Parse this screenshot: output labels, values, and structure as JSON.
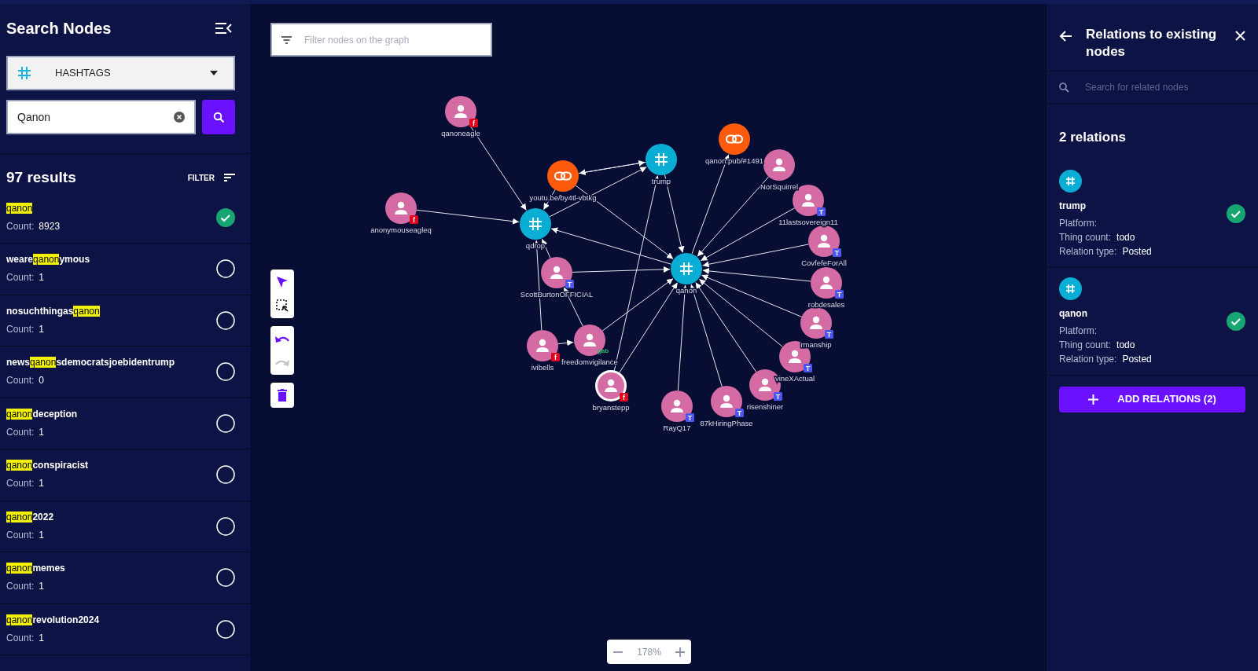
{
  "sidebar": {
    "title": "Search Nodes",
    "type_select": {
      "value": "HASHTAGS"
    },
    "search": {
      "value": "Qanon"
    },
    "results_count": "97 results",
    "filter_label": "FILTER",
    "results": [
      {
        "parts": [
          {
            "text": "qanon",
            "highlighted": true
          }
        ],
        "count_label": "Count:",
        "count": "8923",
        "selected": true
      },
      {
        "parts": [
          {
            "text": "weare",
            "highlighted": false
          },
          {
            "text": "qanon",
            "highlighted": true
          },
          {
            "text": "ymous",
            "highlighted": false
          }
        ],
        "count_label": "Count:",
        "count": "1",
        "selected": false
      },
      {
        "parts": [
          {
            "text": "nosuchthingas",
            "highlighted": false
          },
          {
            "text": "qanon",
            "highlighted": true
          }
        ],
        "count_label": "Count:",
        "count": "1",
        "selected": false
      },
      {
        "parts": [
          {
            "text": "news",
            "highlighted": false
          },
          {
            "text": "qanon",
            "highlighted": true
          },
          {
            "text": "sdemocratsjoebidentrump",
            "highlighted": false
          }
        ],
        "count_label": "Count:",
        "count": "0",
        "selected": false
      },
      {
        "parts": [
          {
            "text": "qanon",
            "highlighted": true
          },
          {
            "text": "deception",
            "highlighted": false
          }
        ],
        "count_label": "Count:",
        "count": "1",
        "selected": false
      },
      {
        "parts": [
          {
            "text": "qanon",
            "highlighted": true
          },
          {
            "text": "conspiracist",
            "highlighted": false
          }
        ],
        "count_label": "Count:",
        "count": "1",
        "selected": false
      },
      {
        "parts": [
          {
            "text": "qanon",
            "highlighted": true
          },
          {
            "text": "2022",
            "highlighted": false
          }
        ],
        "count_label": "Count:",
        "count": "1",
        "selected": false
      },
      {
        "parts": [
          {
            "text": "qanon",
            "highlighted": true
          },
          {
            "text": "memes",
            "highlighted": false
          }
        ],
        "count_label": "Count:",
        "count": "1",
        "selected": false
      },
      {
        "parts": [
          {
            "text": "qanon",
            "highlighted": true
          },
          {
            "text": "revolution2024",
            "highlighted": false
          }
        ],
        "count_label": "Count:",
        "count": "1",
        "selected": false
      }
    ]
  },
  "canvas": {
    "filter": {
      "placeholder": "Filter nodes on the graph"
    },
    "zoom": "178%",
    "toolbar": [
      {
        "tools": [
          {
            "kind": "pointer",
            "selected": true
          },
          {
            "kind": "marquee",
            "selected": false
          }
        ]
      },
      {
        "tools": [
          {
            "kind": "undo",
            "disabled": false
          },
          {
            "kind": "redo",
            "disabled": true
          }
        ]
      },
      {
        "tools": [
          {
            "kind": "delete"
          }
        ]
      }
    ],
    "graph": {
      "nodes": [
        {
          "label": "qanoneagle",
          "kind": "user",
          "badge": {
            "text": "f",
            "kind": "tile",
            "color": "#e0001b"
          },
          "selected": false
        },
        {
          "label": "anonymouseagleq",
          "kind": "user",
          "badge": {
            "text": "f",
            "kind": "tile",
            "color": "#e0001b"
          },
          "selected": false
        },
        {
          "label": "youtu.be/by4tl-vbtkg",
          "kind": "link",
          "selected": false
        },
        {
          "label": "qdrop",
          "kind": "hashtag",
          "selected": false
        },
        {
          "label": "trump",
          "kind": "hashtag",
          "selected": false
        },
        {
          "label": "qanon.pub/#1491",
          "kind": "link",
          "selected": false
        },
        {
          "label": "NorSquirrel",
          "kind": "user",
          "selected": false
        },
        {
          "label": "11lastsovereign11",
          "kind": "user",
          "badge": {
            "text": "T",
            "kind": "tile",
            "color": "#4b55f0"
          },
          "selected": false
        },
        {
          "label": "CovfefeForAll",
          "kind": "user",
          "badge": {
            "text": "T",
            "kind": "tile",
            "color": "#4b55f0"
          },
          "selected": false
        },
        {
          "label": "robdesales",
          "kind": "user",
          "badge": {
            "text": "T",
            "kind": "tile",
            "color": "#4b55f0"
          },
          "selected": false
        },
        {
          "label": "rmanship",
          "kind": "user",
          "badge": {
            "text": "T",
            "kind": "tile",
            "color": "#4b55f0"
          },
          "selected": false
        },
        {
          "label": "vineXActual",
          "kind": "user",
          "badge": {
            "text": "T",
            "kind": "tile",
            "color": "#4b55f0"
          },
          "selected": false
        },
        {
          "label": "ScottBurtonOFFICIAL",
          "kind": "user",
          "badge": {
            "text": "T",
            "kind": "tile",
            "color": "#4b55f0"
          },
          "selected": false
        },
        {
          "label": "qanon",
          "kind": "hashtag",
          "selected": false
        },
        {
          "label": "ivibells",
          "kind": "user",
          "badge": {
            "text": "f",
            "kind": "tile",
            "color": "#e0001b"
          },
          "selected": false
        },
        {
          "label": "freedomvigilance",
          "kind": "user",
          "badge": {
            "text": "gab",
            "kind": "tag",
            "color": "#1fbf6a"
          },
          "selected": false
        },
        {
          "label": "bryanstepp",
          "kind": "user",
          "badge": {
            "text": "f",
            "kind": "tile",
            "color": "#e0001b"
          },
          "selected": true
        },
        {
          "label": "RayQ17",
          "kind": "user",
          "badge": {
            "text": "T",
            "kind": "tile",
            "color": "#4b55f0"
          },
          "selected": false
        },
        {
          "label": "87kHiringPhase",
          "kind": "user",
          "badge": {
            "text": "T",
            "kind": "tile",
            "color": "#4b55f0"
          },
          "selected": false
        },
        {
          "label": "risenshiner",
          "kind": "user",
          "badge": {
            "text": "T",
            "kind": "tile",
            "color": "#4b55f0"
          },
          "selected": false
        }
      ]
    }
  },
  "relations_panel": {
    "title": "Relations to existing nodes",
    "search": {
      "placeholder": "Search for related nodes"
    },
    "count": "2 relations",
    "relations": [
      {
        "name": "trump",
        "kind": "hashtag",
        "fields": [
          {
            "label": "Platform:"
          },
          {
            "label": "Thing count:",
            "value": "todo"
          },
          {
            "label": "Relation type:",
            "value": "Posted"
          }
        ],
        "selected": true
      },
      {
        "name": "qanon",
        "kind": "hashtag",
        "fields": [
          {
            "label": "Platform:"
          },
          {
            "label": "Thing count:",
            "value": "todo"
          },
          {
            "label": "Relation type:",
            "value": "Posted"
          }
        ],
        "selected": true
      }
    ],
    "button": "ADD RELATIONS (2)"
  }
}
